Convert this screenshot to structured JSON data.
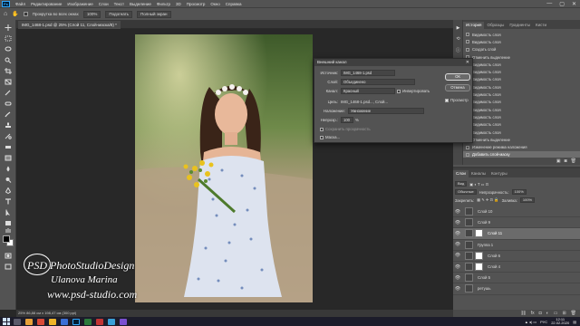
{
  "menubar": {
    "app_logo": "Ps",
    "items": [
      "Файл",
      "Редактирование",
      "Изображение",
      "Слои",
      "Текст",
      "Выделение",
      "Фильтр",
      "3D",
      "Просмотр",
      "Окно",
      "Справка"
    ],
    "window_controls": [
      "—",
      "▢",
      "✕"
    ]
  },
  "options": {
    "scroll_all_label": "Прокрутка во всех окнах",
    "zoom_value": "100%",
    "fit_label": "Подогнать",
    "fullscreen_label": "Полный экран"
  },
  "document_tab": "IMG_1468-1.psd @ 25% (Слой 11, Слой-маска/8) *",
  "watermark": {
    "line1": "PSD PhotoStudioDesign",
    "line2": "Ulanova Marina",
    "line3": "www.psd-studio.com"
  },
  "statusbar": {
    "text": "25%   86,88 см x 198,47 см (300 ppi)"
  },
  "history_panel": {
    "tabs": [
      "История",
      "Образцы",
      "Градиенты",
      "Кисти"
    ],
    "rows": [
      "Видимость слоя",
      "Видимость слоя",
      "Создать слой",
      "Отменить выделение",
      "Видимость слоя",
      "Видимость слоя",
      "Видимость слоя",
      "Видимость слоя",
      "Видимость слоя",
      "Видимость слоя",
      "Видимость слоя",
      "Видимость слоя",
      "Видимость слоя",
      "Видимость слоя",
      "Отменить выделение",
      "Изменение режима наложения",
      "Добавить слой-маску"
    ],
    "selected_index": 16
  },
  "layers_panel": {
    "tabs": [
      "Слои",
      "Каналы",
      "Контуры"
    ],
    "blend_mode": "Обычные",
    "opacity_label": "Непрозрачность:",
    "opacity_value": "100%",
    "fill_label": "Заливка:",
    "fill_value": "100%",
    "lock_label": "Закрепить:",
    "layers": [
      {
        "name": "Слой 10",
        "mask": false
      },
      {
        "name": "Слой 9",
        "mask": false
      },
      {
        "name": "Слой 11",
        "mask": true
      },
      {
        "name": "Группа 1",
        "mask": false
      },
      {
        "name": "Слой 6",
        "mask": true
      },
      {
        "name": "Слой 4",
        "mask": true
      },
      {
        "name": "Слой 5",
        "mask": false
      },
      {
        "name": "ретушь",
        "mask": false
      }
    ],
    "selected_index": 2
  },
  "dialog": {
    "title": "Внешний канал",
    "source_label": "Источник:",
    "source_value": "IMG_1468-1.psd",
    "layer_label": "Слой:",
    "layer_value": "Объединено",
    "channel_label": "Канал:",
    "channel_value": "Красный",
    "invert_label": "Инвертировать",
    "target_label": "Цель:",
    "target_value": "IMG_1468-1.psd..., Слой...",
    "blending_label": "Наложение:",
    "blending_value": "Умножение",
    "opacity_label": "Непрозр.:",
    "opacity_value": "100",
    "opacity_unit": "%",
    "preserve_label": "Сохранить прозрачность",
    "mask_label": "Маска...",
    "ok_label": "ОК",
    "cancel_label": "Отмена",
    "preview_label": "Просмотр"
  },
  "taskbar": {
    "lang": "РУС",
    "time": "12:11",
    "date": "22.02.2020"
  },
  "colors": {
    "panel_bg": "#535353",
    "canvas_bg": "#282828",
    "selected_row": "#6e6e6e",
    "ps_accent": "#31a8ff"
  }
}
